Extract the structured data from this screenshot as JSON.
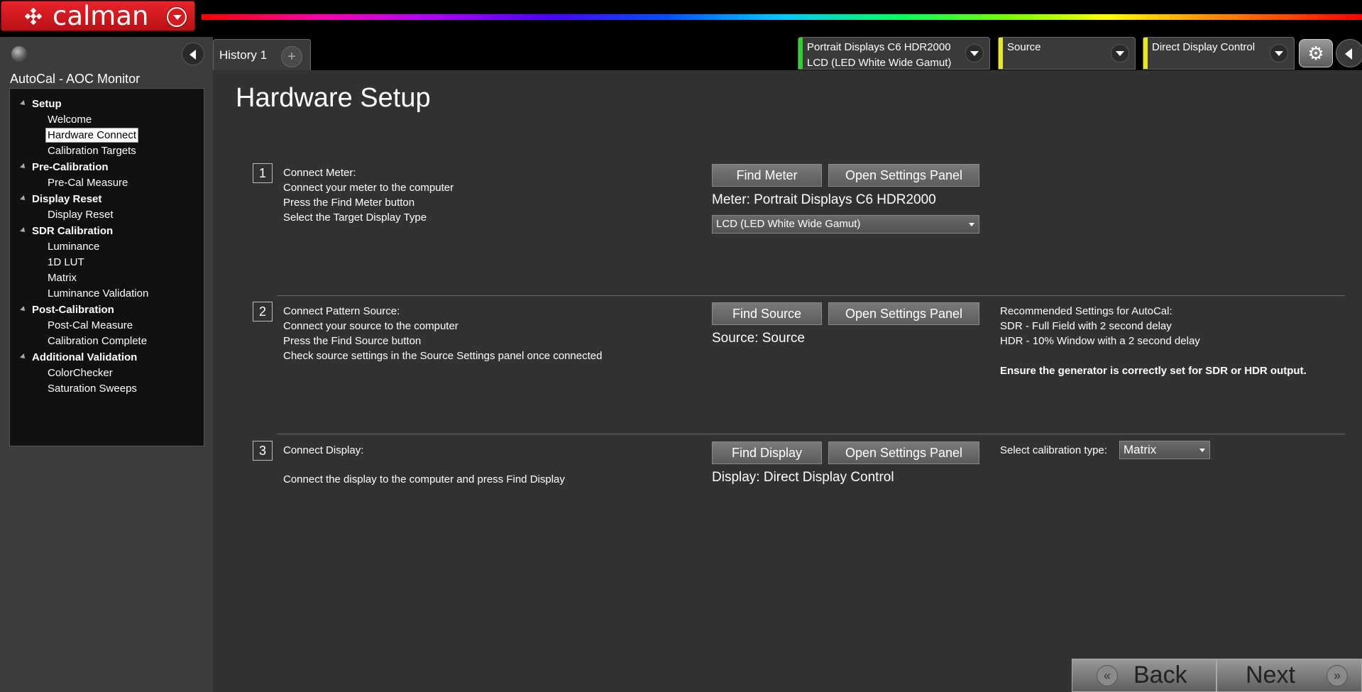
{
  "app": {
    "logo_text": "calman"
  },
  "left_panel": {
    "title": "AutoCal - AOC Monitor",
    "sections": [
      {
        "label": "Setup",
        "items": [
          "Welcome",
          "Hardware Connect",
          "Calibration Targets"
        ]
      },
      {
        "label": "Pre-Calibration",
        "items": [
          "Pre-Cal Measure"
        ]
      },
      {
        "label": "Display Reset",
        "items": [
          "Display Reset"
        ]
      },
      {
        "label": "SDR Calibration",
        "items": [
          "Luminance",
          "1D LUT",
          "Matrix",
          "Luminance Validation"
        ]
      },
      {
        "label": "Post-Calibration",
        "items": [
          "Post-Cal Measure",
          "Calibration Complete"
        ]
      },
      {
        "label": "Additional Validation",
        "items": [
          "ColorChecker",
          "Saturation Sweeps"
        ]
      }
    ],
    "selected_item": "Hardware Connect"
  },
  "tabs": {
    "history_label": "History 1",
    "add_label": "+"
  },
  "devices": {
    "meter": {
      "line1": "Portrait Displays C6 HDR2000",
      "line2": "LCD (LED White Wide Gamut)",
      "color": "#2fd12f"
    },
    "source": {
      "line1": "Source",
      "color": "#e8e81a"
    },
    "display": {
      "line1": "Direct Display Control",
      "color": "#e8e81a"
    }
  },
  "icons": {
    "gear": "⚙"
  },
  "main": {
    "title": "Hardware Setup",
    "steps": [
      {
        "number": "1",
        "lines": [
          "Connect Meter:",
          "Connect your meter to the computer",
          "Press the Find Meter button",
          "Select the Target Display Type"
        ],
        "find_label": "Find Meter",
        "settings_label": "Open Settings Panel",
        "status": "Meter: Portrait Displays C6 HDR2000",
        "select_value": "LCD (LED White Wide Gamut)"
      },
      {
        "number": "2",
        "lines": [
          "Connect Pattern Source:",
          "Connect your source to the computer",
          "Press the Find Source button",
          "Check source settings in the Source Settings panel once connected"
        ],
        "find_label": "Find Source",
        "settings_label": "Open Settings Panel",
        "status": "Source: Source",
        "rec_lines": [
          "Recommended Settings for AutoCal:",
          "SDR - Full Field with 2 second delay",
          "HDR - 10% Window with a 2 second delay"
        ],
        "rec_strong": "Ensure the generator is correctly set for SDR or HDR output."
      },
      {
        "number": "3",
        "lines": [
          "Connect Display:",
          "",
          "Connect the display to the computer and press Find Display"
        ],
        "find_label": "Find Display",
        "settings_label": "Open Settings Panel",
        "status": "Display: Direct Display Control",
        "cal_type_label": "Select calibration type:",
        "cal_type_value": "Matrix"
      }
    ]
  },
  "nav": {
    "back_label": "Back",
    "next_label": "Next",
    "back_icon": "«",
    "next_icon": "»"
  }
}
